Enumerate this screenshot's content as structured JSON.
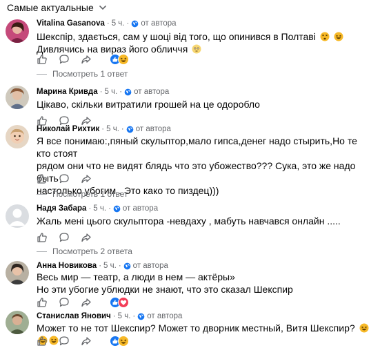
{
  "sort": {
    "label": "Самые актуальные"
  },
  "comments": [
    {
      "author": "Vitalina Gasanova",
      "time": "5 ч.",
      "privacy": "от автора",
      "lines": [
        "Шекспір, здається, сам у шоці від того, що опинився в Полтаві",
        "Дивлячись на вираз його обличчя"
      ],
      "replies_label": "Посмотреть 1 ответ"
    },
    {
      "author": "Марина Кривда",
      "time": "5 ч.",
      "privacy": "от автора",
      "lines": [
        "Цікаво, скільки витратили грошей на це одоробло"
      ]
    },
    {
      "author": "Николай Рихтик",
      "time": "5 ч.",
      "privacy": "от автора",
      "lines": [
        "Я все понимаю:,пяный скульптор,мало гипса,денег надо стырить,Но те кто стоят",
        "рядом они что не видят блядь что это убожество??? Сука, это же надо быть",
        "настолько убогим . Это како то пиздец)))"
      ],
      "replies_label": "Посмотреть 1 ответ"
    },
    {
      "author": "Надя Забара",
      "time": "5 ч.",
      "privacy": "от автора",
      "lines": [
        "Жаль мені цього скульптора -невдаху , мабуть навчався онлайн ....."
      ],
      "replies_label": "Посмотреть 2 ответа"
    },
    {
      "author": "Анна Новикова",
      "time": "5 ч.",
      "privacy": "от автора",
      "lines": [
        "Весь мир — театр, а люди в нем — актёры»",
        "Но эти убогие ублюдки не знают, что это сказал Шекспир"
      ]
    },
    {
      "author": "Станислав Янович",
      "time": "5 ч.",
      "privacy": "от автора",
      "lines": [
        "Может то не тот Шекспир? Может то дворник местный, Витя Шекспир?"
      ]
    }
  ],
  "icons": {
    "like": "thumb-up-icon",
    "reply": "comment-bubble-icon",
    "share": "share-icon",
    "privacy": "globe-icon",
    "sort": "chevron-down-icon"
  },
  "colors": {
    "meta": "#65676b",
    "link_like": "#1877f2",
    "haha": "#f7b928",
    "love": "#f33e58"
  }
}
